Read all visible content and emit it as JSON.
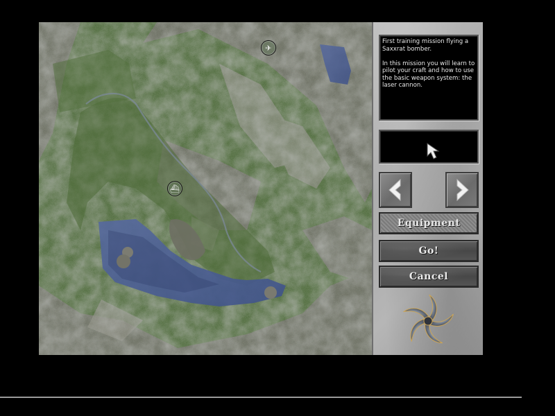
{
  "briefing": {
    "text": "First training mission flying a Saxxrat bomber.\n\nIn this mission you will learn to pilot your craft and how to use the basic weapon system: the laser cannon."
  },
  "map": {
    "markers": [
      {
        "id": "aircraft-marker",
        "icon": "aircraft-icon",
        "glyph": "✈"
      },
      {
        "id": "ship-marker",
        "icon": "ship-icon",
        "glyph": "⛴"
      }
    ]
  },
  "preview": {
    "icon": "cursor-arrow-icon"
  },
  "nav": {
    "prev_icon": "chevron-left-icon",
    "next_icon": "chevron-right-icon"
  },
  "buttons": {
    "equipment": "Equipment",
    "go": "Go!",
    "cancel": "Cancel"
  },
  "logo": {
    "icon": "starfish-emblem-icon"
  },
  "colors": {
    "panel": "#b0b0b0",
    "screen_bg": "#000000",
    "water": "#4a5f96",
    "terrain": "#4f6a3c"
  }
}
